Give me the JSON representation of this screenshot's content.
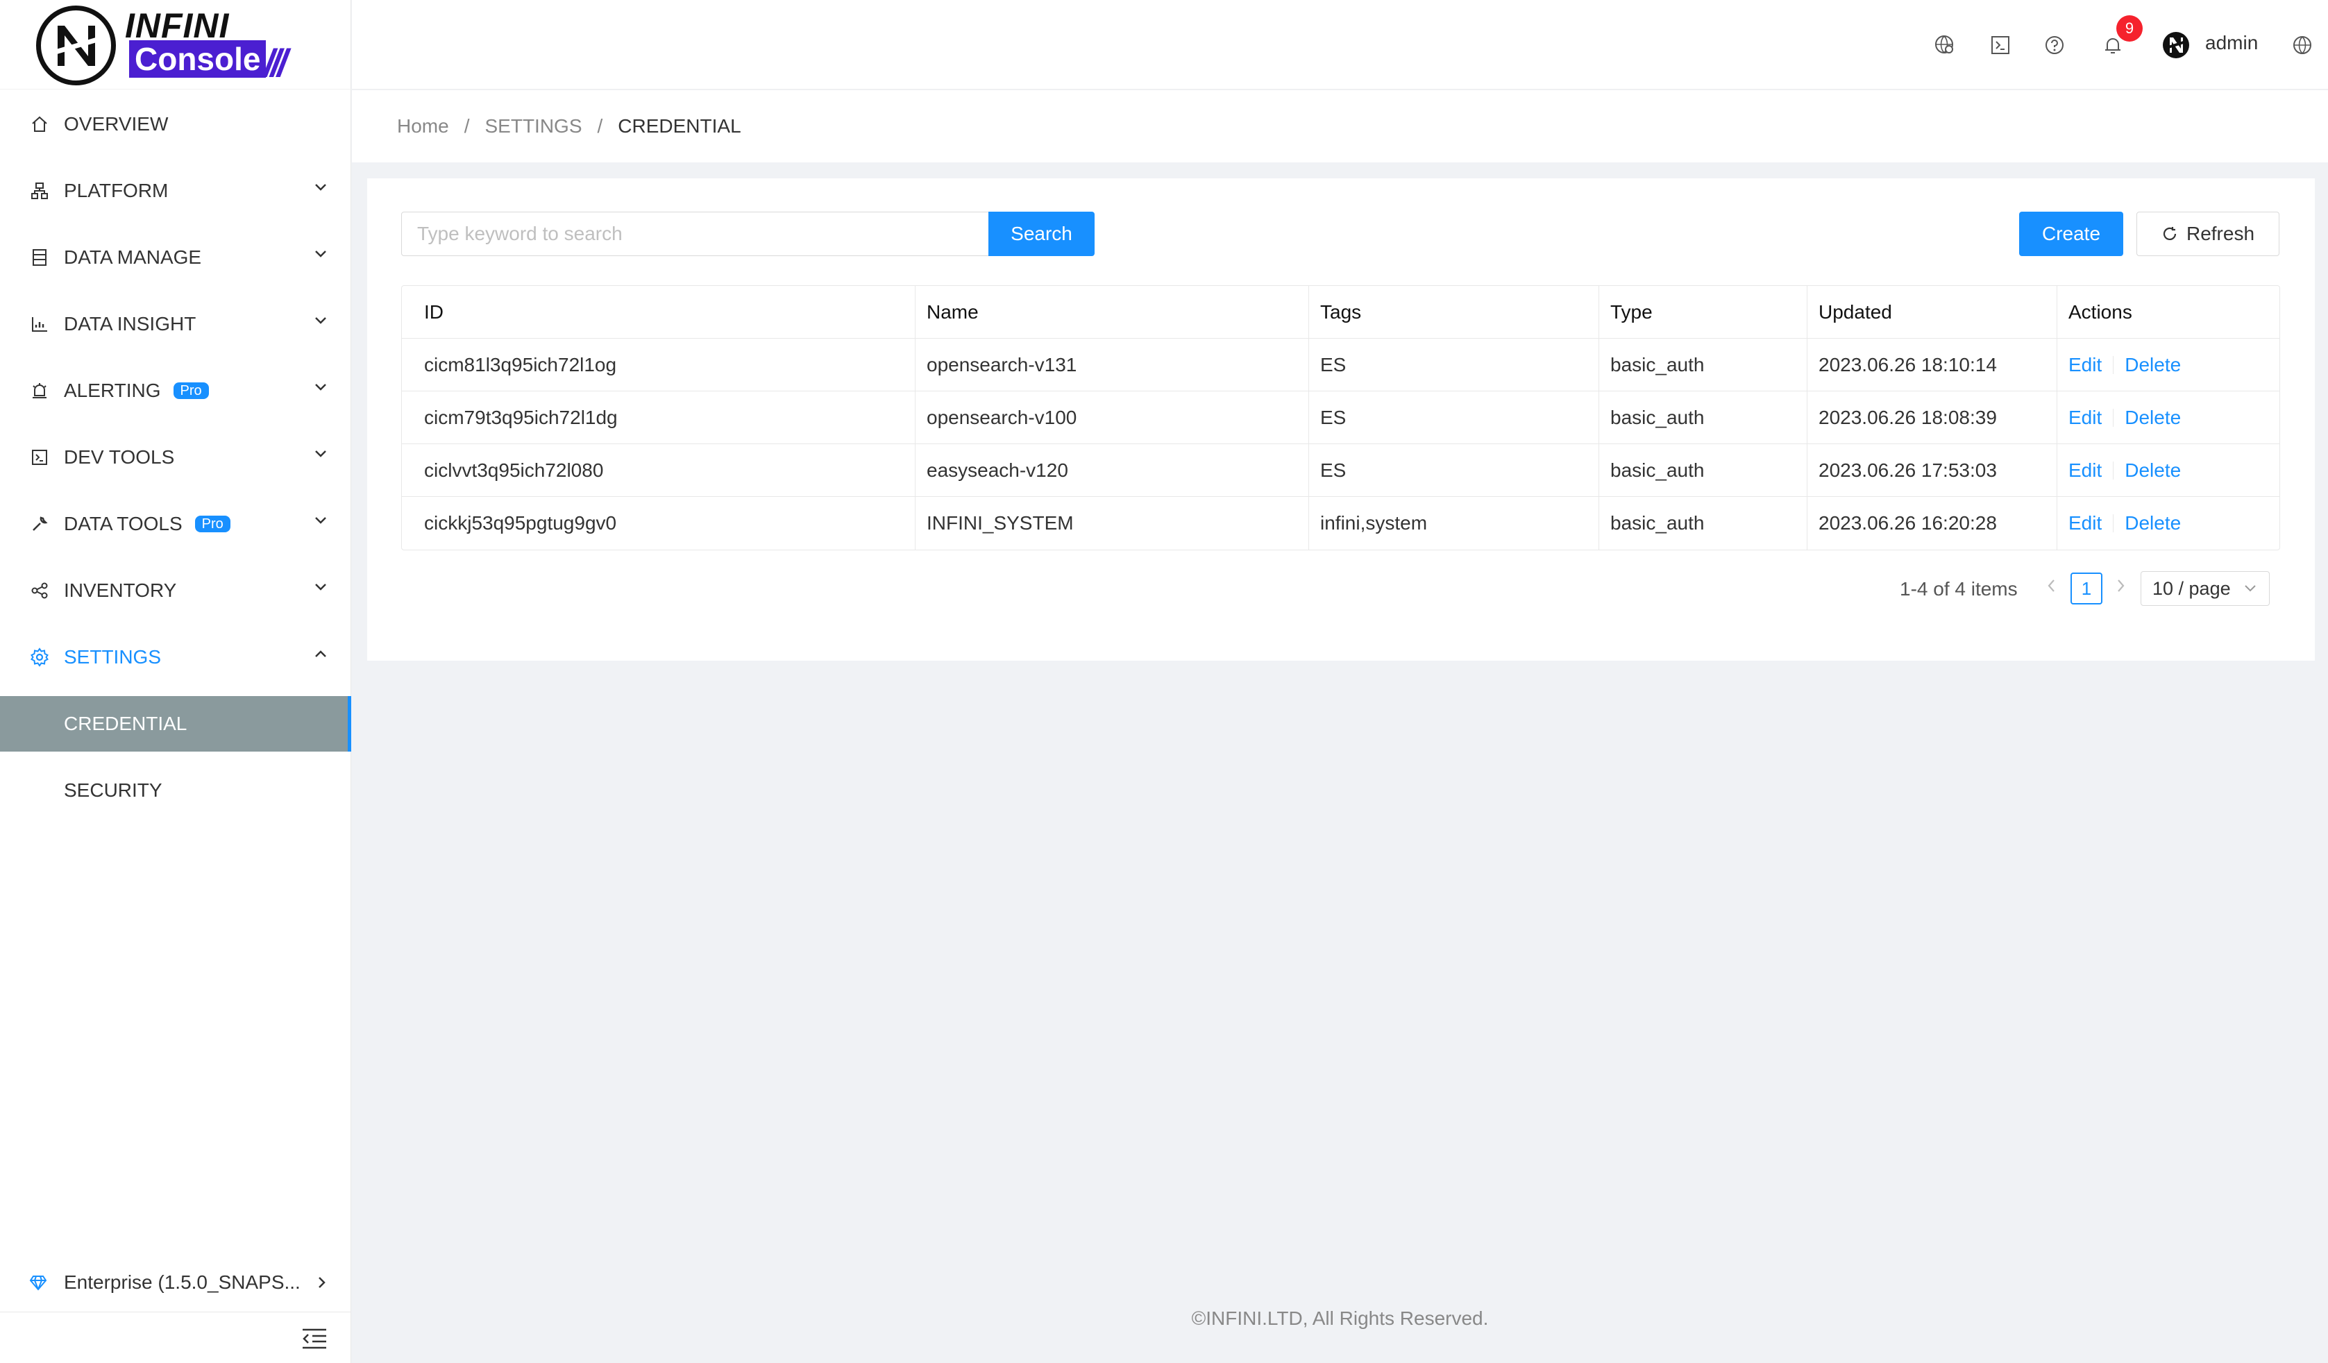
{
  "brand": {
    "word1": "INFINI",
    "word2": "Console",
    "slashes": "///"
  },
  "sidebar": {
    "items": [
      {
        "label": "OVERVIEW",
        "icon": "home-icon"
      },
      {
        "label": "PLATFORM",
        "icon": "sitemap-icon"
      },
      {
        "label": "DATA MANAGE",
        "icon": "database-icon"
      },
      {
        "label": "DATA INSIGHT",
        "icon": "chart-icon"
      },
      {
        "label": "ALERTING",
        "icon": "alarm-icon",
        "badge": "Pro"
      },
      {
        "label": "DEV TOOLS",
        "icon": "terminal-icon"
      },
      {
        "label": "DATA TOOLS",
        "icon": "wrench-icon",
        "badge": "Pro"
      },
      {
        "label": "INVENTORY",
        "icon": "share-icon"
      },
      {
        "label": "SETTINGS",
        "icon": "gear-icon"
      }
    ],
    "sub_items": [
      {
        "label": "CREDENTIAL"
      },
      {
        "label": "SECURITY"
      }
    ],
    "enterprise": "Enterprise (1.5.0_SNAPS..."
  },
  "header": {
    "notification_count": "9",
    "user": "admin"
  },
  "breadcrumb": {
    "home": "Home",
    "sep": "/",
    "section": "SETTINGS",
    "current": "CREDENTIAL"
  },
  "toolbar": {
    "search_placeholder": "Type keyword to search",
    "search_label": "Search",
    "create_label": "Create",
    "refresh_label": "Refresh"
  },
  "table": {
    "headers": [
      "ID",
      "Name",
      "Tags",
      "Type",
      "Updated",
      "Actions"
    ],
    "rows": [
      {
        "id": "cicm81l3q95ich72l1og",
        "name": "opensearch-v131",
        "tags": "ES",
        "type": "basic_auth",
        "updated": "2023.06.26 18:10:14",
        "edit": "Edit",
        "delete": "Delete"
      },
      {
        "id": "cicm79t3q95ich72l1dg",
        "name": "opensearch-v100",
        "tags": "ES",
        "type": "basic_auth",
        "updated": "2023.06.26 18:08:39",
        "edit": "Edit",
        "delete": "Delete"
      },
      {
        "id": "ciclvvt3q95ich72l080",
        "name": "easyseach-v120",
        "tags": "ES",
        "type": "basic_auth",
        "updated": "2023.06.26 17:53:03",
        "edit": "Edit",
        "delete": "Delete"
      },
      {
        "id": "cickkj53q95pgtug9gv0",
        "name": "INFINI_SYSTEM",
        "tags": "infini,system",
        "type": "basic_auth",
        "updated": "2023.06.26 16:20:28",
        "edit": "Edit",
        "delete": "Delete"
      }
    ]
  },
  "pagination": {
    "total": "1-4 of 4 items",
    "current_page": "1",
    "page_size": "10 / page"
  },
  "footer": "©INFINI.LTD, All Rights Reserved.",
  "colors": {
    "accent": "#1890ff",
    "brand": "#4b1fd1",
    "selected_bg": "#8a9a9d",
    "badge": "#f5222d"
  }
}
